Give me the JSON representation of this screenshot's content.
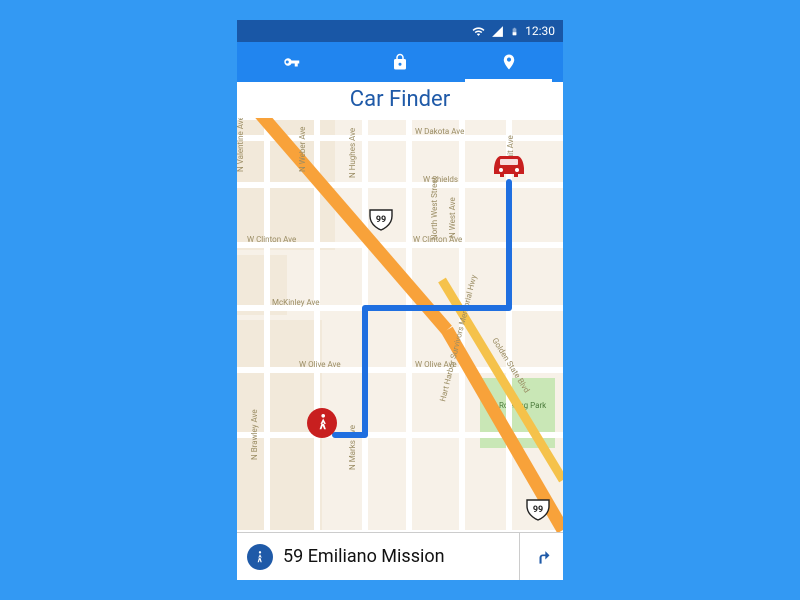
{
  "status": {
    "time": "12:30"
  },
  "tabs": [
    {
      "name": "key",
      "active": false
    },
    {
      "name": "lock",
      "active": false
    },
    {
      "name": "location",
      "active": true
    }
  ],
  "title": "Car Finder",
  "map": {
    "highway": "99",
    "park": "Roeding Park",
    "streets": [
      "W Dakota Ave",
      "N Fruit Ave",
      "W Shields",
      "N Valentine Ave",
      "N Weber Ave",
      "N Hughes Ave",
      "W Clinton Ave",
      "McKinley Ave",
      "W Olive Ave",
      "N Brawley Ave",
      "N Marks Ave",
      "N West Ave",
      "North West Street",
      "Hart Harbor Survivors Memorial Hwy",
      "Golden State Blvd"
    ]
  },
  "destination": {
    "address": "59 Emiliano Mission"
  }
}
